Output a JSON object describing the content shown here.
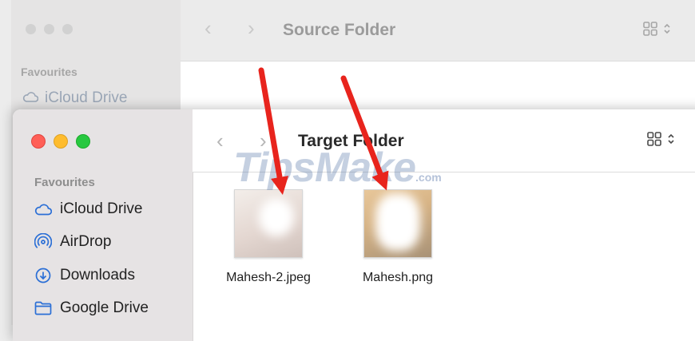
{
  "source_window": {
    "title": "Source Folder",
    "sidebar": {
      "heading": "Favourites",
      "items": [
        {
          "label": "iCloud Drive",
          "icon": "cloud-icon"
        }
      ]
    }
  },
  "target_window": {
    "title": "Target Folder",
    "sidebar": {
      "heading": "Favourites",
      "items": [
        {
          "label": "iCloud Drive",
          "icon": "cloud-icon"
        },
        {
          "label": "AirDrop",
          "icon": "airdrop-icon"
        },
        {
          "label": "Downloads",
          "icon": "download-icon"
        },
        {
          "label": "Google Drive",
          "icon": "folder-icon"
        }
      ]
    },
    "files": [
      {
        "name": "Mahesh-2.jpeg"
      },
      {
        "name": "Mahesh.png"
      }
    ]
  },
  "watermark": {
    "text": "TipsMake",
    "suffix": ".com"
  },
  "colors": {
    "arrow": "#e8241d",
    "traffic_red": "#ff5f57",
    "traffic_yellow": "#febc2e",
    "traffic_green": "#28c840",
    "sidebar_icon_blue": "#2b6fd6"
  }
}
